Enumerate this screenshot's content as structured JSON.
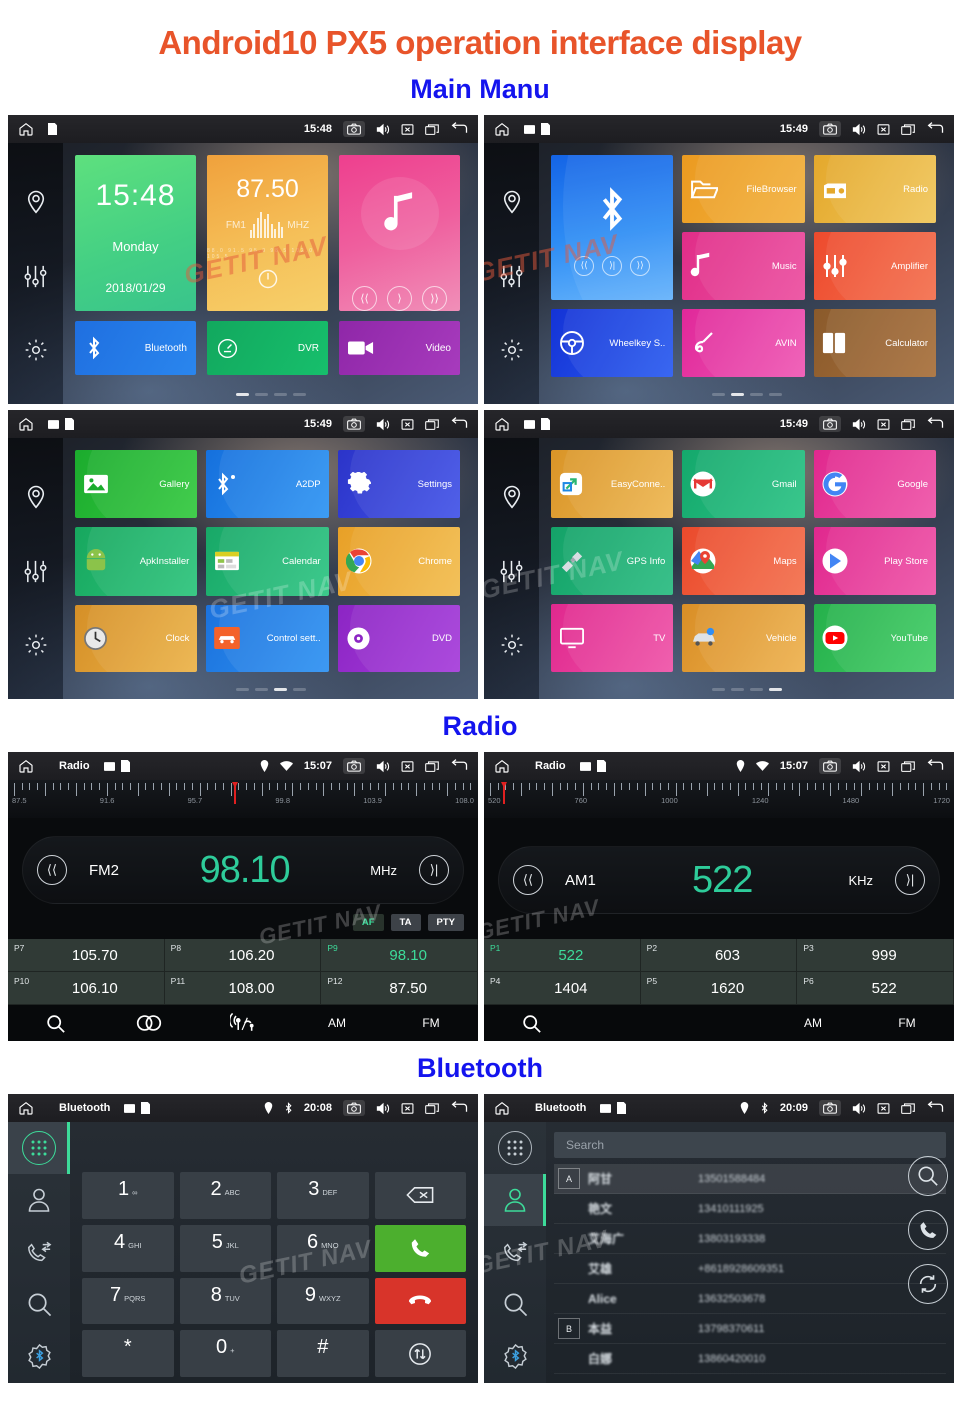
{
  "header": {
    "title": "Android10 PX5 operation interface display",
    "sections": {
      "main_menu": "Main Manu",
      "radio": "Radio",
      "bluetooth": "Bluetooth"
    }
  },
  "watermark": "GETIT NAV",
  "screens": {
    "home1": {
      "status": {
        "time": "15:48",
        "title": ""
      },
      "clock_widget": {
        "time": "15:48",
        "day": "Monday",
        "date": "2018/01/29"
      },
      "radio_widget": {
        "freq": "87.50",
        "band": "FM1",
        "unit": "MHZ",
        "scale": "88.0  91.5  95.0  98.5  102.0  105.5"
      },
      "tiles": [
        {
          "label": "Bluetooth",
          "icon": "bluetooth-icon"
        },
        {
          "label": "DVR",
          "icon": "dvr-icon"
        },
        {
          "label": "Video",
          "icon": "video-icon"
        }
      ],
      "page_dots": 4,
      "active_dot": 0
    },
    "home2": {
      "status": {
        "time": "15:49"
      },
      "bt_widget": {
        "icon": "bluetooth-icon"
      },
      "apps": [
        {
          "label": "FileBrowser",
          "icon": "folder-icon"
        },
        {
          "label": "Radio",
          "icon": "radio-icon"
        },
        {
          "label": "Music",
          "icon": "music-note-icon"
        },
        {
          "label": "Amplifier",
          "icon": "equalizer-icon"
        },
        {
          "label": "Wheelkey S..",
          "icon": "steering-wheel-icon"
        },
        {
          "label": "AVIN",
          "icon": "avin-plug-icon"
        },
        {
          "label": "Calculator",
          "icon": "calculator-icon"
        }
      ],
      "page_dots": 4,
      "active_dot": 1
    },
    "home3": {
      "status": {
        "time": "15:49"
      },
      "apps": [
        {
          "label": "Gallery",
          "icon": "gallery-icon"
        },
        {
          "label": "A2DP",
          "icon": "a2dp-icon"
        },
        {
          "label": "Settings",
          "icon": "gear-icon"
        },
        {
          "label": "ApkInstaller",
          "icon": "android-wrench-icon"
        },
        {
          "label": "Calendar",
          "icon": "calendar-icon"
        },
        {
          "label": "Chrome",
          "icon": "chrome-icon"
        },
        {
          "label": "Clock",
          "icon": "clock-icon"
        },
        {
          "label": "Control sett..",
          "icon": "car-control-icon"
        },
        {
          "label": "DVD",
          "icon": "dvd-disc-icon"
        }
      ],
      "page_dots": 4,
      "active_dot": 2
    },
    "home4": {
      "status": {
        "time": "15:49"
      },
      "apps": [
        {
          "label": "EasyConne..",
          "icon": "easyconnect-icon"
        },
        {
          "label": "Gmail",
          "icon": "gmail-icon"
        },
        {
          "label": "Google",
          "icon": "google-icon"
        },
        {
          "label": "GPS Info",
          "icon": "satellite-icon"
        },
        {
          "label": "Maps",
          "icon": "maps-icon"
        },
        {
          "label": "Play Store",
          "icon": "play-store-icon"
        },
        {
          "label": "TV",
          "icon": "tv-icon"
        },
        {
          "label": "Vehicle",
          "icon": "vehicle-icon"
        },
        {
          "label": "YouTube",
          "icon": "youtube-icon"
        }
      ],
      "page_dots": 4,
      "active_dot": 3
    },
    "radio_fm": {
      "status": {
        "title": "Radio",
        "time": "15:07"
      },
      "scale_labels": [
        "87.5",
        "91.6",
        "95.7",
        "99.8",
        "103.9",
        "108.0"
      ],
      "needle_pct": 48,
      "band": "FM2",
      "frequency": "98.10",
      "unit": "MHz",
      "rds": [
        {
          "label": "AF",
          "active": true
        },
        {
          "label": "TA",
          "active": false
        },
        {
          "label": "PTY",
          "active": false
        }
      ],
      "presets": [
        {
          "n": "P7",
          "v": "105.70",
          "active": false
        },
        {
          "n": "P8",
          "v": "106.20",
          "active": false
        },
        {
          "n": "P9",
          "v": "98.10",
          "active": true
        },
        {
          "n": "P10",
          "v": "106.10",
          "active": false
        },
        {
          "n": "P11",
          "v": "108.00",
          "active": false
        },
        {
          "n": "P12",
          "v": "87.50",
          "active": false
        }
      ],
      "bottom": [
        "search-icon",
        "stereo-icon",
        "antenna-icon",
        "AM",
        "FM"
      ]
    },
    "radio_am": {
      "status": {
        "title": "Radio",
        "time": "15:07"
      },
      "scale_labels": [
        "520",
        "760",
        "1000",
        "1240",
        "1480",
        "1720"
      ],
      "needle_pct": 4,
      "band": "AM1",
      "frequency": "522",
      "unit": "KHz",
      "presets": [
        {
          "n": "P1",
          "v": "522",
          "active": true
        },
        {
          "n": "P2",
          "v": "603",
          "active": false
        },
        {
          "n": "P3",
          "v": "999",
          "active": false
        },
        {
          "n": "P4",
          "v": "1404",
          "active": false
        },
        {
          "n": "P5",
          "v": "1620",
          "active": false
        },
        {
          "n": "P6",
          "v": "522",
          "active": false
        }
      ],
      "bottom": [
        "search-icon",
        "AM",
        "FM"
      ]
    },
    "bt_dialpad": {
      "status": {
        "title": "Bluetooth",
        "time": "20:08"
      },
      "sidebar": [
        "dialpad-icon",
        "contacts-icon",
        "call-history-icon",
        "search-icon",
        "bluetooth-settings-icon"
      ],
      "keys": [
        {
          "num": "1",
          "sub": "∞"
        },
        {
          "num": "2",
          "sub": "ABC"
        },
        {
          "num": "3",
          "sub": "DEF"
        },
        {
          "num": "",
          "sub": "",
          "fn": "backspace-icon"
        },
        {
          "num": "4",
          "sub": "GHI"
        },
        {
          "num": "5",
          "sub": "JKL"
        },
        {
          "num": "6",
          "sub": "MNO"
        },
        {
          "num": "",
          "sub": "",
          "fn": "call-icon"
        },
        {
          "num": "7",
          "sub": "PQRS"
        },
        {
          "num": "8",
          "sub": "TUV"
        },
        {
          "num": "9",
          "sub": "WXYZ"
        },
        {
          "num": "",
          "sub": "",
          "fn": "hangup-icon"
        },
        {
          "num": "*",
          "sub": ""
        },
        {
          "num": "0",
          "sub": "+"
        },
        {
          "num": "#",
          "sub": ""
        },
        {
          "num": "",
          "sub": "",
          "fn": "transfer-icon"
        }
      ]
    },
    "bt_contacts": {
      "status": {
        "title": "Bluetooth",
        "time": "20:09"
      },
      "search_placeholder": "Search",
      "contacts": [
        {
          "alpha": "A",
          "name": "阿甘",
          "number": "13501588484",
          "highlight": true
        },
        {
          "alpha": "",
          "name": "艳文",
          "number": "13410111925"
        },
        {
          "alpha": "",
          "name": "艾海广",
          "number": "13803193338"
        },
        {
          "alpha": "",
          "name": "艾雄",
          "number": "+8618928609351"
        },
        {
          "alpha": "",
          "name": "Alice",
          "number": "13632503678"
        },
        {
          "alpha": "B",
          "name": "本益",
          "number": "13798370611"
        },
        {
          "alpha": "",
          "name": "白娜",
          "number": "13860420010"
        }
      ],
      "actions": [
        "search-icon",
        "call-icon",
        "sync-icon"
      ]
    }
  }
}
